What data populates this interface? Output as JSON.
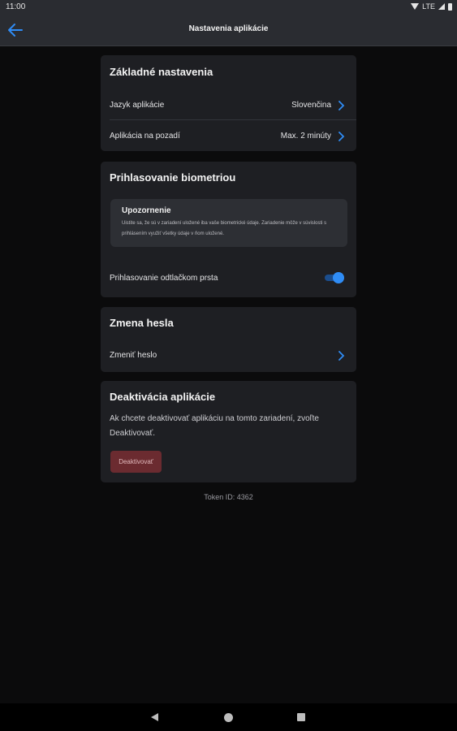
{
  "status_bar": {
    "time": "11:00",
    "network": "LTE"
  },
  "app_bar": {
    "title": "Nastavenia aplikácie"
  },
  "basic_settings": {
    "title": "Základné nastavenia",
    "language_label": "Jazyk aplikácie",
    "language_value": "Slovenčina",
    "background_label": "Aplikácia na pozadí",
    "background_value": "Max. 2 minúty"
  },
  "biometrics": {
    "title": "Prihlasovanie biometriou",
    "notice_title": "Upozornenie",
    "notice_text": "Uistite sa, že sú v zariadení uložené iba vaše biometrické údaje. Zariadenie môže v súvislosti s prihlásením využiť všetky údaje v ňom uložené.",
    "fingerprint_label": "Prihlasovanie odtlačkom prsta",
    "fingerprint_enabled": true
  },
  "password": {
    "title": "Zmena hesla",
    "change_label": "Zmeniť heslo"
  },
  "deactivation": {
    "title": "Deaktivácia aplikácie",
    "description": "Ak chcete deaktivovať aplikáciu na tomto zariadení, zvoľte Deaktivovať.",
    "button_label": "Deaktivovať"
  },
  "token_id": "Token ID: 4362",
  "colors": {
    "accent": "#2f8cf5",
    "card_bg": "#1e1f23",
    "danger_button": "#6b2b30"
  }
}
